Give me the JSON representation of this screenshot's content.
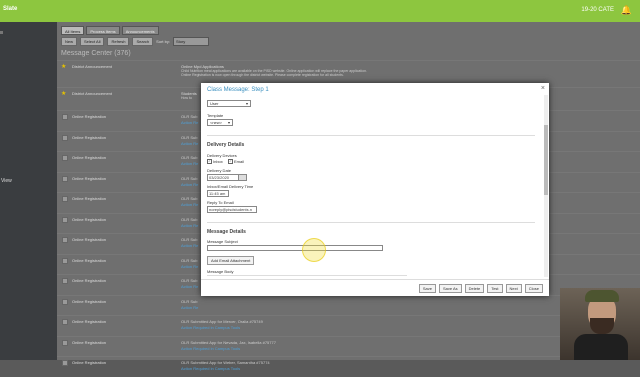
{
  "header": {
    "logo": "Slate",
    "date_label": "19-20 CATE"
  },
  "sidebar": {
    "view_label": "View"
  },
  "toolbar": {
    "tabs": [
      "All Items",
      "Process Items",
      "Announcements"
    ],
    "buttons": [
      "New",
      "Select All",
      "Refresh",
      "Search"
    ],
    "sort_label": "Sort by:",
    "sort_value": "Story"
  },
  "message_center": {
    "title": "Message Center (376)",
    "announcement_1": {
      "type": "District Announcement",
      "title": "Online Mpd Applications",
      "line2": "Child Nutrition meal applications are available on the PISD website. Online application will replace the paper application.",
      "line3": "Online Registration is now open through the district website. Please complete registration for all students."
    },
    "announcement_2": {
      "type": "District Announcement",
      "title": "Students",
      "line2": "How to"
    },
    "rows": [
      {
        "type": "Online Registration",
        "subject": "OLR Sub",
        "action": "Action Re"
      },
      {
        "type": "Online Registration",
        "subject": "OLR Sub",
        "action": "Action Re"
      },
      {
        "type": "Online Registration",
        "subject": "OLR Sub",
        "action": "Action Re"
      },
      {
        "type": "Online Registration",
        "subject": "OLR Sub",
        "action": "Action Re"
      },
      {
        "type": "Online Registration",
        "subject": "OLR Sub",
        "action": "Action Re"
      },
      {
        "type": "Online Registration",
        "subject": "OLR Sub",
        "action": "Action Re"
      },
      {
        "type": "Online Registration",
        "subject": "OLR Sub",
        "action": "Action Re"
      },
      {
        "type": "Online Registration",
        "subject": "OLR Sub",
        "action": "Action Re"
      },
      {
        "type": "Online Registration",
        "subject": "OLR Sub",
        "action": "Action Re"
      },
      {
        "type": "Online Registration",
        "subject": "OLR Sub",
        "action": "Action Re"
      },
      {
        "type": "Online Registration",
        "subject": "OLR Submitted App for Mercer, Oralia #75749",
        "action": "Action Required in Campus Tools"
      },
      {
        "type": "Online Registration",
        "subject": "OLR Submitted App for Nevada, Jax, Isabella #75777",
        "action": "Action Required in Campus Tools"
      },
      {
        "type": "Online Registration",
        "subject": "OLR Submitted App for Weber, Samantha #75774",
        "action": "Action Required in Campus Tools"
      }
    ]
  },
  "modal": {
    "title": "Class Message: Step 1",
    "user_value": "User",
    "template_label": "Template",
    "template_value": "<new>",
    "delivery_section": "Delivery Details",
    "delivery_devices_label": "Delivery Devices",
    "inbox_label": "Inbox",
    "email_label": "Email",
    "delivery_date_label": "Delivery Date",
    "delivery_date_value": "03/23/2020",
    "delivery_time_label": "Inbox/Email Delivery Time",
    "delivery_time_value": "11:45 am",
    "reply_to_label": "Reply To Email",
    "reply_to_value": "noreply@pisdstudents.n",
    "message_section": "Message Details",
    "subject_label": "Message Subject",
    "subject_value": "",
    "attach_button": "Add Email Attachment",
    "body_label": "Message Body",
    "footer_buttons": [
      "Save",
      "Save As",
      "Delete",
      "Test",
      "Next",
      "Close"
    ]
  }
}
